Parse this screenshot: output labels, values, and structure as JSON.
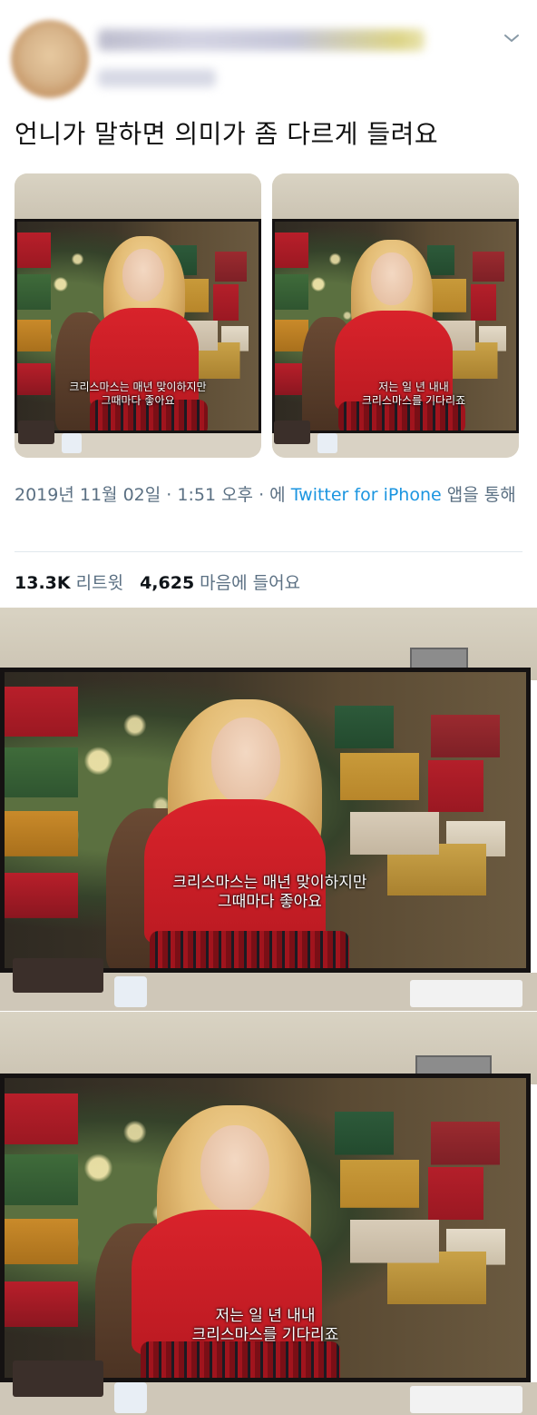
{
  "tweet": {
    "text": "언니가 말하면 의미가 좀 다르게 들려요",
    "photos": [
      {
        "subtitle_lines": [
          "크리스마스는 매년 맞이하지만",
          "그때마다 좋아요"
        ]
      },
      {
        "subtitle_lines": [
          "저는 일 년 내내",
          "크리스마스를 기다리죠"
        ]
      }
    ],
    "meta": {
      "date": "2019년 11월 02일",
      "sep1": " · ",
      "time": "1:51 오후",
      "sep2": " · ",
      "via_prefix": "에 ",
      "app": "Twitter for iPhone",
      "via_suffix": " 앱을 통해"
    },
    "stats": {
      "retweets_count": "13.3K",
      "retweets_label": "리트윗",
      "likes_count": "4,625",
      "likes_label": "마음에 들어요"
    }
  },
  "photos_below": [
    {
      "subtitle_lines": [
        "크리스마스는 매년 맞이하지만",
        "그때마다 좋아요"
      ]
    },
    {
      "subtitle_lines": [
        "저는 일 년 내내",
        "크리스마스를 기다리죠"
      ]
    }
  ],
  "icons": {
    "menu": "chevron-down-icon"
  }
}
